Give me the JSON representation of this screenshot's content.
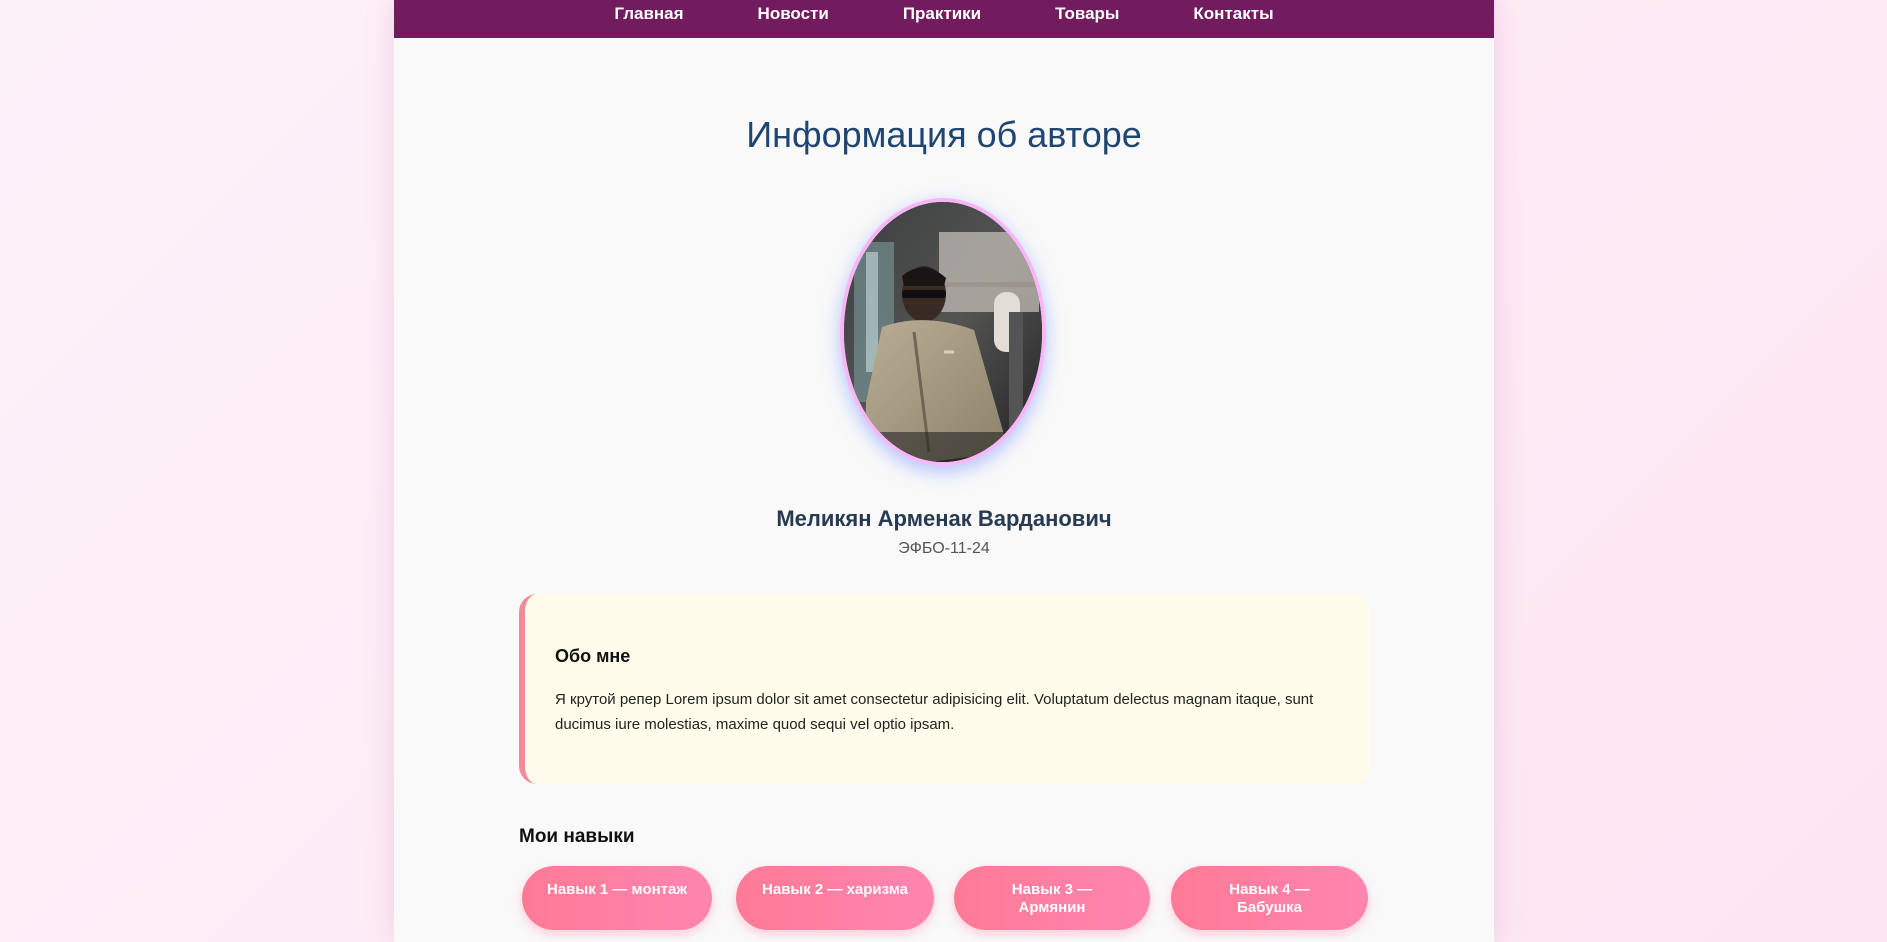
{
  "nav": {
    "items": [
      "Главная",
      "Новости",
      "Практики",
      "Товары",
      "Контакты"
    ]
  },
  "page": {
    "title": "Информация об авторе"
  },
  "author": {
    "name": "Меликян Арменак Варданович",
    "group": "ЭФБО-11-24",
    "photo_alt": "Фото автора"
  },
  "about": {
    "title": "Обо мне",
    "text": "Я крутой репер Lorem ipsum dolor sit amet consectetur adipisicing elit. Voluptatum delectus magnam itaque, sunt ducimus iure molestias, maxime quod sequi vel optio ipsam."
  },
  "skills": {
    "title": "Мои навыки",
    "items": [
      "Навык 1 — монтаж",
      "Навык 2 — харизма",
      "Навык 3 — Армянин",
      "Навык 4 — Бабушка"
    ]
  },
  "colors": {
    "nav_bg": "#721c5f",
    "title": "#1f4573",
    "accent_border": "#f08c9a",
    "chip": "#ff7a96"
  }
}
